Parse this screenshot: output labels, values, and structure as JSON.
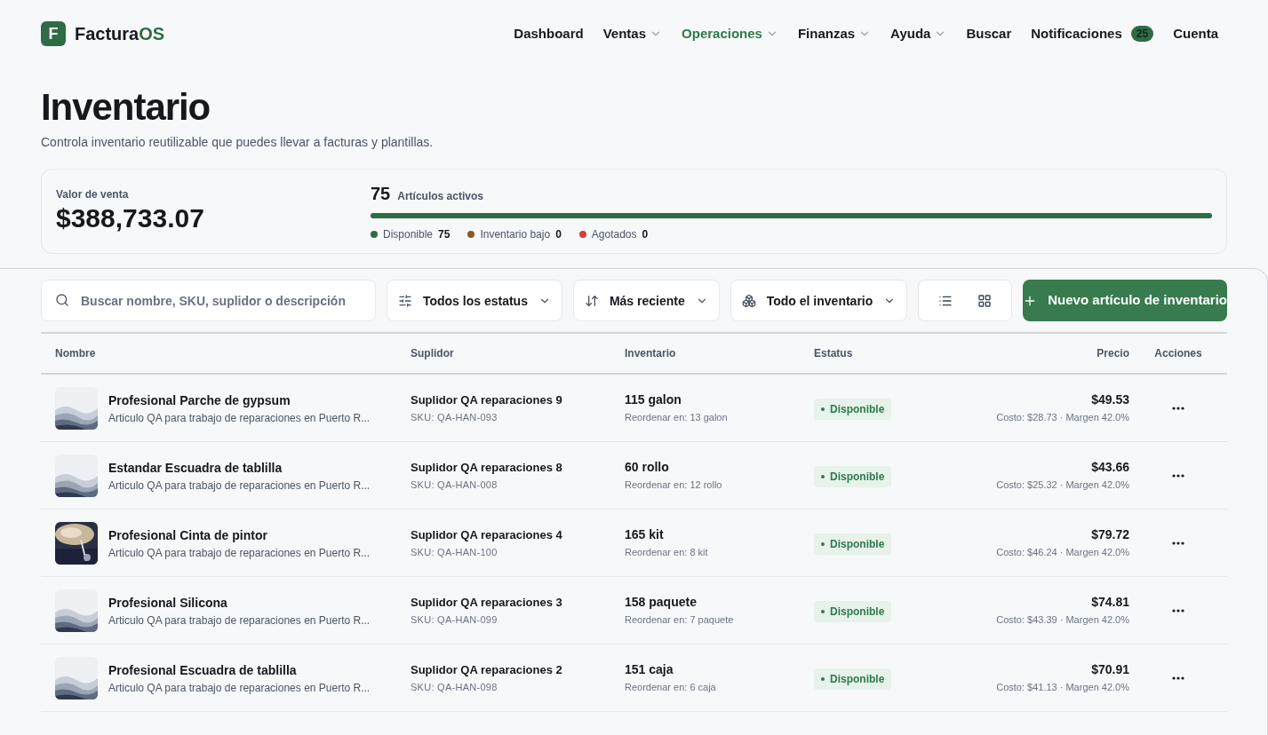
{
  "brand": {
    "name": "Factura",
    "accent": "OS",
    "logo_letter": "F"
  },
  "nav": [
    {
      "label": "Dashboard",
      "kind": "link",
      "selected": false
    },
    {
      "label": "Ventas",
      "kind": "menu",
      "selected": false
    },
    {
      "label": "Operaciones",
      "kind": "menu",
      "selected": true
    },
    {
      "label": "Finanzas",
      "kind": "menu",
      "selected": false
    },
    {
      "label": "Ayuda",
      "kind": "menu",
      "selected": false
    },
    {
      "label": "Buscar",
      "kind": "link",
      "selected": false
    },
    {
      "label": "Notificaciones",
      "kind": "badge",
      "badge": "25",
      "selected": false
    },
    {
      "label": "Cuenta",
      "kind": "link",
      "selected": false
    }
  ],
  "page": {
    "title": "Inventario",
    "subtitle": "Controla inventario reutilizable que puedes llevar a facturas y plantillas."
  },
  "summary": {
    "value_label": "Valor de venta",
    "value": "$388,733.07",
    "active_count": "75",
    "active_label": "Artículos activos",
    "level": 1,
    "legend": [
      {
        "label": "Disponible",
        "count": "75",
        "color": "#2f6b45"
      },
      {
        "label": "Inventario bajo",
        "count": "0",
        "color": "#8a5a1e"
      },
      {
        "label": "Agotados",
        "count": "0",
        "color": "#d04040"
      }
    ]
  },
  "toolbar": {
    "search_placeholder": "Buscar nombre, SKU, suplidor o descripción",
    "filters": [
      {
        "label": "Todos los estatus",
        "kind": "sliders"
      },
      {
        "label": "Más reciente",
        "kind": "sort"
      },
      {
        "label": "Todo el inventario",
        "kind": "boxes"
      }
    ],
    "views": [
      {
        "kind": "list",
        "selected": false
      },
      {
        "kind": "grid",
        "selected": false
      }
    ],
    "new_button": "Nuevo artículo de inventario"
  },
  "table": {
    "columns": [
      "Nombre",
      "Suplidor",
      "Inventario",
      "Estatus",
      "Precio",
      "Acciones"
    ],
    "rows": [
      {
        "name": "Profesional Parche de gypsum",
        "description": "Articulo QA para trabajo de reparaciones en Puerto R...",
        "supplier": "Suplidor QA reparaciones 9",
        "sku": "SKU: QA-HAN-093",
        "stock": "115 galon",
        "reorder": "Reordenar en: 13 galon",
        "status": "Disponible",
        "price": "$49.53",
        "cost": "Costo: $28.73 · Margen 42.0%"
      },
      {
        "name": "Estandar Escuadra de tablilla",
        "description": "Articulo QA para trabajo de reparaciones en Puerto R...",
        "supplier": "Suplidor QA reparaciones 8",
        "sku": "SKU: QA-HAN-008",
        "stock": "60 rollo",
        "reorder": "Reordenar en: 12 rollo",
        "status": "Disponible",
        "price": "$43.66",
        "cost": "Costo: $25.32 · Margen 42.0%"
      },
      {
        "name": "Profesional Cinta de pintor",
        "description": "Articulo QA para trabajo de reparaciones en Puerto R...",
        "supplier": "Suplidor QA reparaciones 4",
        "sku": "SKU: QA-HAN-100",
        "stock": "165 kit",
        "reorder": "Reordenar en: 8 kit",
        "status": "Disponible",
        "price": "$79.72",
        "cost": "Costo: $46.24 · Margen 42.0%"
      },
      {
        "name": "Profesional Silicona",
        "description": "Articulo QA para trabajo de reparaciones en Puerto R...",
        "supplier": "Suplidor QA reparaciones 3",
        "sku": "SKU: QA-HAN-099",
        "stock": "158 paquete",
        "reorder": "Reordenar en: 7 paquete",
        "status": "Disponible",
        "price": "$74.81",
        "cost": "Costo: $43.39 · Margen 42.0%"
      },
      {
        "name": "Profesional Escuadra de tablilla",
        "description": "Articulo QA para trabajo de reparaciones en Puerto R...",
        "supplier": "Suplidor QA reparaciones 2",
        "sku": "SKU: QA-HAN-098",
        "stock": "151 caja",
        "reorder": "Reordenar en: 6 caja",
        "status": "Disponible",
        "price": "$70.91",
        "cost": "Costo: $41.13 · Margen 42.0%"
      }
    ]
  }
}
